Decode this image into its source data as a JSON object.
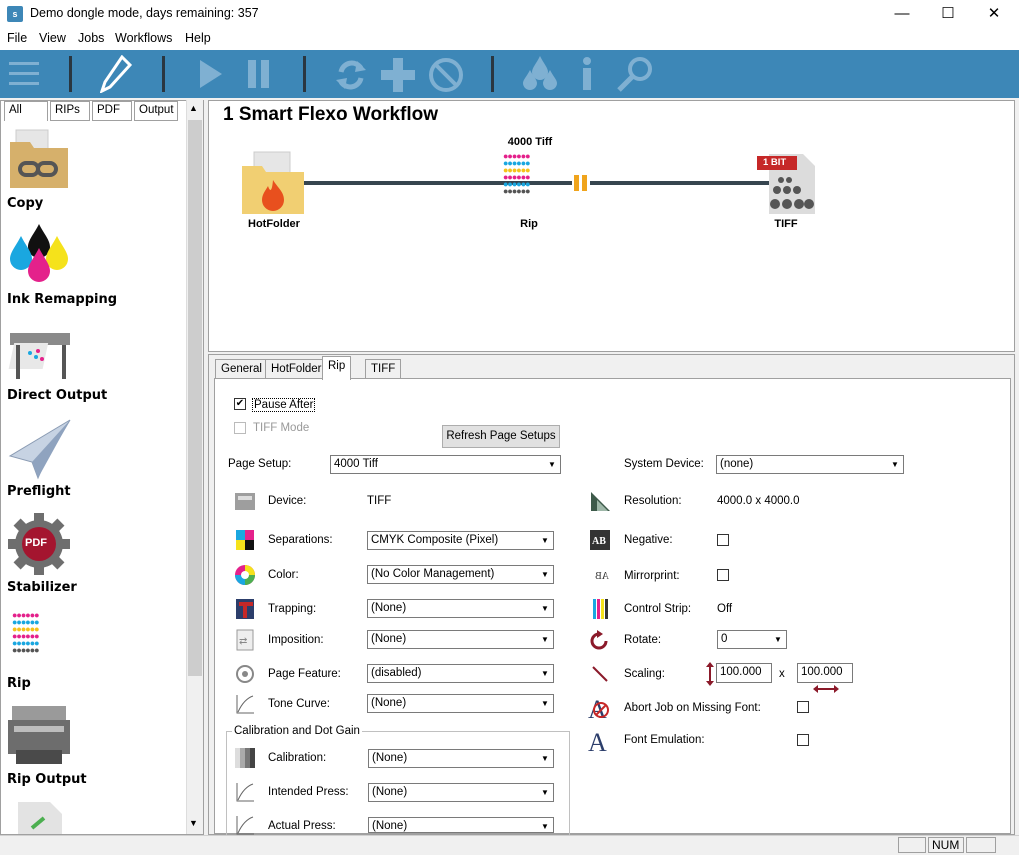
{
  "window": {
    "title": "Demo dongle mode, days remaining: 357",
    "minimize": "—",
    "maximize": "☐",
    "close": "✕"
  },
  "menu": [
    "File",
    "View",
    "Jobs",
    "Workflows",
    "Help"
  ],
  "left_tabs": [
    "All",
    "RIPs",
    "PDF",
    "Output"
  ],
  "tools": [
    {
      "label": "Copy",
      "icon": "folder-link-icon"
    },
    {
      "label": "Ink Remapping",
      "icon": "ink-drops-icon"
    },
    {
      "label": "Direct Output",
      "icon": "wide-printer-icon"
    },
    {
      "label": "Preflight",
      "icon": "paper-plane-icon"
    },
    {
      "label": "Stabilizer",
      "icon": "pdf-gear-icon"
    },
    {
      "label": "Rip",
      "icon": "halftone-dots-icon"
    },
    {
      "label": "Rip Output",
      "icon": "printer-icon"
    }
  ],
  "stabilizer_badge": "PDF",
  "workflow": {
    "title": "1 Smart Flexo Workflow",
    "nodes": [
      {
        "label": "HotFolder",
        "icon": "hotfolder-fire-icon"
      },
      {
        "label": "Rip",
        "caption": "4000 Tiff",
        "icon": "halftone-dots-icon"
      },
      {
        "label": "TIFF",
        "badge": "1 BIT",
        "icon": "tiff-file-icon"
      }
    ]
  },
  "prop_tabs": [
    "General",
    "HotFolder",
    "Rip",
    "TIFF"
  ],
  "rip": {
    "pause_after": "Pause After",
    "tiff_mode": "TIFF Mode",
    "refresh_button": "Refresh Page Setups",
    "page_setup_label": "Page Setup:",
    "page_setup_value": "4000 Tiff",
    "system_device_label": "System Device:",
    "system_device_value": "(none)",
    "left_rows": [
      {
        "label": "Device:",
        "value": "TIFF",
        "type": "text"
      },
      {
        "label": "Separations:",
        "value": "CMYK Composite (Pixel)",
        "type": "select"
      },
      {
        "label": "Color:",
        "value": "(No Color Management)",
        "type": "select"
      },
      {
        "label": "Trapping:",
        "value": "(None)",
        "type": "select"
      },
      {
        "label": "Imposition:",
        "value": "(None)",
        "type": "select"
      },
      {
        "label": "Page Feature:",
        "value": "(disabled)",
        "type": "select"
      },
      {
        "label": "Tone Curve:",
        "value": "(None)",
        "type": "select"
      }
    ],
    "calibration_group": "Calibration and Dot Gain",
    "calib_rows": [
      {
        "label": "Calibration:",
        "value": "(None)"
      },
      {
        "label": "Intended Press:",
        "value": "(None)"
      },
      {
        "label": "Actual Press:",
        "value": "(None)"
      }
    ],
    "resolution_label": "Resolution:",
    "resolution_value": "4000.0 x 4000.0",
    "negative_label": "Negative:",
    "mirrorprint_label": "Mirrorprint:",
    "control_strip_label": "Control Strip:",
    "control_strip_value": "Off",
    "rotate_label": "Rotate:",
    "rotate_value": "0",
    "scaling_label": "Scaling:",
    "scaling_x": "100.000",
    "scaling_sep": "x",
    "scaling_y": "100.000",
    "abort_label": "Abort Job on Missing Font:",
    "font_emulation_label": "Font Emulation:"
  },
  "status": {
    "num": "NUM"
  },
  "colors": {
    "toolbar": "#3d87b7",
    "accent_red": "#d32f2f"
  }
}
